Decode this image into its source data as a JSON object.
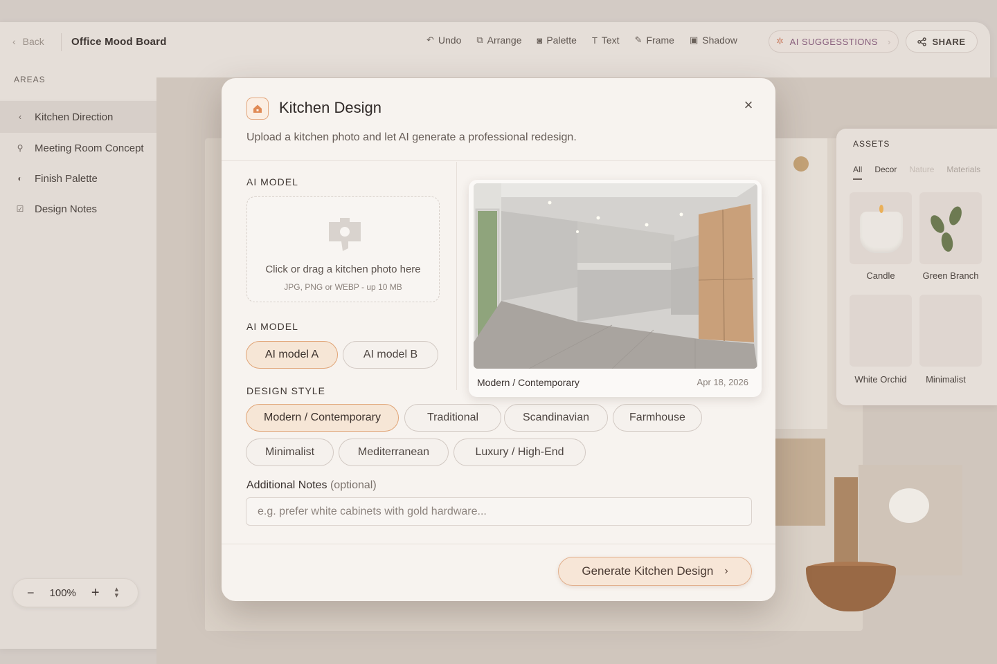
{
  "header": {
    "back_label": "Back",
    "board_title": "Office Mood Board",
    "tools": [
      {
        "label": "Undo",
        "icon": "undo-icon"
      },
      {
        "label": "Arrange",
        "icon": "arrange-icon"
      },
      {
        "label": "Palette",
        "icon": "palette-icon"
      },
      {
        "label": "Text",
        "icon": "text-icon"
      },
      {
        "label": "Frame",
        "icon": "frame-icon"
      },
      {
        "label": "Shadow",
        "icon": "shadow-icon"
      }
    ],
    "ai_suggestions_label": "AI SUGGESSTIONS",
    "share_label": "SHARE"
  },
  "sidebar": {
    "section_label": "AREAS",
    "items": [
      {
        "label": "Kitchen Direction",
        "icon": "chevron-left-icon",
        "active": true
      },
      {
        "label": "Meeting Room Concept",
        "icon": "pin-icon",
        "active": false
      },
      {
        "label": "Finish Palette",
        "icon": "palette-icon",
        "active": false
      },
      {
        "label": "Design Notes",
        "icon": "checkbox-icon",
        "active": false
      }
    ]
  },
  "zoom": {
    "minus": "−",
    "value": "100%",
    "plus": "+"
  },
  "assets": {
    "title": "ASSETS",
    "tabs": [
      "All",
      "Decor",
      "Nature",
      "Materials"
    ],
    "items": [
      "Candle",
      "Green Branch",
      "White Orchid",
      "Minimalist"
    ]
  },
  "modal": {
    "title": "Kitchen Design",
    "subtitle": "Upload a kitchen photo and let AI generate a professional redesign.",
    "close_label": "×",
    "upload": {
      "label": "AI MODEL",
      "prompt": "Click or drag a kitchen photo here",
      "hint": "JPG, PNG or WEBP - up 10 MB"
    },
    "model": {
      "label": "AI MODEL",
      "options": [
        "AI model A",
        "AI model B"
      ],
      "selected": "AI model A"
    },
    "style": {
      "label": "DESIGN STYLE",
      "options": [
        "Modern / Contemporary",
        "Traditional",
        "Scandinavian",
        "Farmhouse",
        "Minimalist",
        "Mediterranean",
        "Luxury / High-End"
      ],
      "selected": "Modern / Contemporary"
    },
    "preview": {
      "style": "Modern / Contemporary",
      "date": "Apr 18, 2026"
    },
    "notes": {
      "label": "Additional Notes",
      "optional": "(optional)",
      "placeholder": "e.g. prefer white cabinets with gold hardware...",
      "value": ""
    },
    "generate_label": "Generate Kitchen Design"
  },
  "colors": {
    "accent": "#e0a476",
    "accent_bg": "#f6e6d6",
    "modal_bg": "#f7f3ef",
    "app_bg": "#ece6e1"
  }
}
